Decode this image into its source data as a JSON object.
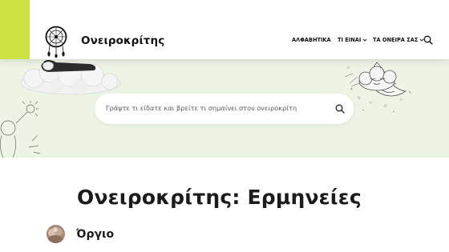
{
  "header": {
    "brand": "Ονειροκρίτης",
    "nav": [
      {
        "label": "ΑΛΦΑΒΗΤΙΚΑ",
        "has_dropdown": false
      },
      {
        "label": "ΤΙ ΕΙΝΑΙ",
        "has_dropdown": true
      },
      {
        "label": "ΤΑ ΟΝΕΙΡΑ ΣΑΣ",
        "has_dropdown": true
      }
    ],
    "search_icon": "search-icon",
    "logo_icon": "dreamcatcher-icon"
  },
  "hero": {
    "search_placeholder": "Γράψτε τι είδατε και βρείτε τι σημαίνει στον ονειροκρίτη",
    "search_icon": "search-icon"
  },
  "main": {
    "title": "Ονειροκρίτης: Ερμηνείες",
    "entries": [
      {
        "label": "Όργιο"
      }
    ]
  },
  "colors": {
    "accent": "#cfe243",
    "hero_bg": "#eef4e4",
    "text": "#1b1b1b"
  }
}
